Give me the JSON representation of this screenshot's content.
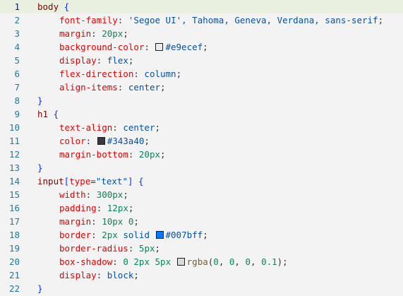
{
  "lines": [
    {
      "n": "1",
      "tokens": [
        {
          "t": "body",
          "c": "sel"
        },
        {
          "t": " ",
          "c": "pun"
        },
        {
          "t": "{",
          "c": "brk"
        }
      ]
    },
    {
      "n": "2",
      "indent": 1,
      "tokens": [
        {
          "t": "font-family",
          "c": "prop"
        },
        {
          "t": ": ",
          "c": "pun"
        },
        {
          "t": "'Segoe UI', Tahoma, Geneva, Verdana, sans-serif",
          "c": "val"
        },
        {
          "t": ";",
          "c": "pun"
        }
      ]
    },
    {
      "n": "3",
      "indent": 1,
      "tokens": [
        {
          "t": "margin",
          "c": "prop"
        },
        {
          "t": ": ",
          "c": "pun"
        },
        {
          "t": "20",
          "c": "num"
        },
        {
          "t": "px",
          "c": "unit"
        },
        {
          "t": ";",
          "c": "pun"
        }
      ]
    },
    {
      "n": "4",
      "indent": 1,
      "tokens": [
        {
          "t": "background-color",
          "c": "prop"
        },
        {
          "t": ": ",
          "c": "pun"
        },
        {
          "swatch": "#e9ecef"
        },
        {
          "t": "#e9ecef",
          "c": "hex"
        },
        {
          "t": ";",
          "c": "pun"
        }
      ]
    },
    {
      "n": "5",
      "indent": 1,
      "tokens": [
        {
          "t": "display",
          "c": "prop"
        },
        {
          "t": ": ",
          "c": "pun"
        },
        {
          "t": "flex",
          "c": "val"
        },
        {
          "t": ";",
          "c": "pun"
        }
      ]
    },
    {
      "n": "6",
      "indent": 1,
      "tokens": [
        {
          "t": "flex-direction",
          "c": "prop"
        },
        {
          "t": ": ",
          "c": "pun"
        },
        {
          "t": "column",
          "c": "val"
        },
        {
          "t": ";",
          "c": "pun"
        }
      ]
    },
    {
      "n": "7",
      "indent": 1,
      "tokens": [
        {
          "t": "align-items",
          "c": "prop"
        },
        {
          "t": ": ",
          "c": "pun"
        },
        {
          "t": "center",
          "c": "val"
        },
        {
          "t": ";",
          "c": "pun"
        }
      ]
    },
    {
      "n": "8",
      "tokens": [
        {
          "t": "}",
          "c": "brk"
        }
      ]
    },
    {
      "n": "9",
      "tokens": [
        {
          "t": "h1",
          "c": "sel"
        },
        {
          "t": " ",
          "c": "pun"
        },
        {
          "t": "{",
          "c": "brk"
        }
      ]
    },
    {
      "n": "10",
      "indent": 1,
      "tokens": [
        {
          "t": "text-align",
          "c": "prop"
        },
        {
          "t": ": ",
          "c": "pun"
        },
        {
          "t": "center",
          "c": "val"
        },
        {
          "t": ";",
          "c": "pun"
        }
      ]
    },
    {
      "n": "11",
      "indent": 1,
      "tokens": [
        {
          "t": "color",
          "c": "prop"
        },
        {
          "t": ": ",
          "c": "pun"
        },
        {
          "swatch": "#343a40"
        },
        {
          "t": "#343a40",
          "c": "hex"
        },
        {
          "t": ";",
          "c": "pun"
        }
      ]
    },
    {
      "n": "12",
      "indent": 1,
      "tokens": [
        {
          "t": "margin-bottom",
          "c": "prop"
        },
        {
          "t": ": ",
          "c": "pun"
        },
        {
          "t": "20",
          "c": "num"
        },
        {
          "t": "px",
          "c": "unit"
        },
        {
          "t": ";",
          "c": "pun"
        }
      ]
    },
    {
      "n": "13",
      "tokens": [
        {
          "t": "}",
          "c": "brk"
        }
      ]
    },
    {
      "n": "14",
      "tokens": [
        {
          "t": "input",
          "c": "sel"
        },
        {
          "t": "[",
          "c": "brk"
        },
        {
          "t": "type",
          "c": "prop"
        },
        {
          "t": "=",
          "c": "pun"
        },
        {
          "t": "\"text\"",
          "c": "val"
        },
        {
          "t": "]",
          "c": "brk"
        },
        {
          "t": " ",
          "c": "pun"
        },
        {
          "t": "{",
          "c": "brk"
        }
      ]
    },
    {
      "n": "15",
      "indent": 1,
      "tokens": [
        {
          "t": "width",
          "c": "prop"
        },
        {
          "t": ": ",
          "c": "pun"
        },
        {
          "t": "300",
          "c": "num"
        },
        {
          "t": "px",
          "c": "unit"
        },
        {
          "t": ";",
          "c": "pun"
        }
      ]
    },
    {
      "n": "16",
      "indent": 1,
      "tokens": [
        {
          "t": "padding",
          "c": "prop"
        },
        {
          "t": ": ",
          "c": "pun"
        },
        {
          "t": "12",
          "c": "num"
        },
        {
          "t": "px",
          "c": "unit"
        },
        {
          "t": ";",
          "c": "pun"
        }
      ]
    },
    {
      "n": "17",
      "indent": 1,
      "tokens": [
        {
          "t": "margin",
          "c": "prop"
        },
        {
          "t": ": ",
          "c": "pun"
        },
        {
          "t": "10",
          "c": "num"
        },
        {
          "t": "px",
          "c": "unit"
        },
        {
          "t": " ",
          "c": "pun"
        },
        {
          "t": "0",
          "c": "num"
        },
        {
          "t": ";",
          "c": "pun"
        }
      ]
    },
    {
      "n": "18",
      "indent": 1,
      "tokens": [
        {
          "t": "border",
          "c": "prop"
        },
        {
          "t": ": ",
          "c": "pun"
        },
        {
          "t": "2",
          "c": "num"
        },
        {
          "t": "px",
          "c": "unit"
        },
        {
          "t": " solid ",
          "c": "val"
        },
        {
          "swatch": "#007bff"
        },
        {
          "t": "#007bff",
          "c": "hex"
        },
        {
          "t": ";",
          "c": "pun"
        }
      ]
    },
    {
      "n": "19",
      "indent": 1,
      "tokens": [
        {
          "t": "border-radius",
          "c": "prop"
        },
        {
          "t": ": ",
          "c": "pun"
        },
        {
          "t": "5",
          "c": "num"
        },
        {
          "t": "px",
          "c": "unit"
        },
        {
          "t": ";",
          "c": "pun"
        }
      ]
    },
    {
      "n": "20",
      "indent": 1,
      "tokens": [
        {
          "t": "box-shadow",
          "c": "prop"
        },
        {
          "t": ": ",
          "c": "pun"
        },
        {
          "t": "0",
          "c": "num"
        },
        {
          "t": " ",
          "c": "pun"
        },
        {
          "t": "2",
          "c": "num"
        },
        {
          "t": "px",
          "c": "unit"
        },
        {
          "t": " ",
          "c": "pun"
        },
        {
          "t": "5",
          "c": "num"
        },
        {
          "t": "px",
          "c": "unit"
        },
        {
          "t": " ",
          "c": "pun"
        },
        {
          "swatch": "rgba(0,0,0,0.1)"
        },
        {
          "t": "rgba",
          "c": "fn"
        },
        {
          "t": "(",
          "c": "pun"
        },
        {
          "t": "0",
          "c": "num"
        },
        {
          "t": ", ",
          "c": "pun"
        },
        {
          "t": "0",
          "c": "num"
        },
        {
          "t": ", ",
          "c": "pun"
        },
        {
          "t": "0",
          "c": "num"
        },
        {
          "t": ", ",
          "c": "pun"
        },
        {
          "t": "0.1",
          "c": "num"
        },
        {
          "t": ")",
          "c": "pun"
        },
        {
          "t": ";",
          "c": "pun"
        }
      ]
    },
    {
      "n": "21",
      "indent": 1,
      "tokens": [
        {
          "t": "display",
          "c": "prop"
        },
        {
          "t": ": ",
          "c": "pun"
        },
        {
          "t": "block",
          "c": "val"
        },
        {
          "t": ";",
          "c": "pun"
        }
      ]
    },
    {
      "n": "22",
      "tokens": [
        {
          "t": "}",
          "c": "brk"
        }
      ]
    }
  ],
  "active_line": "1"
}
